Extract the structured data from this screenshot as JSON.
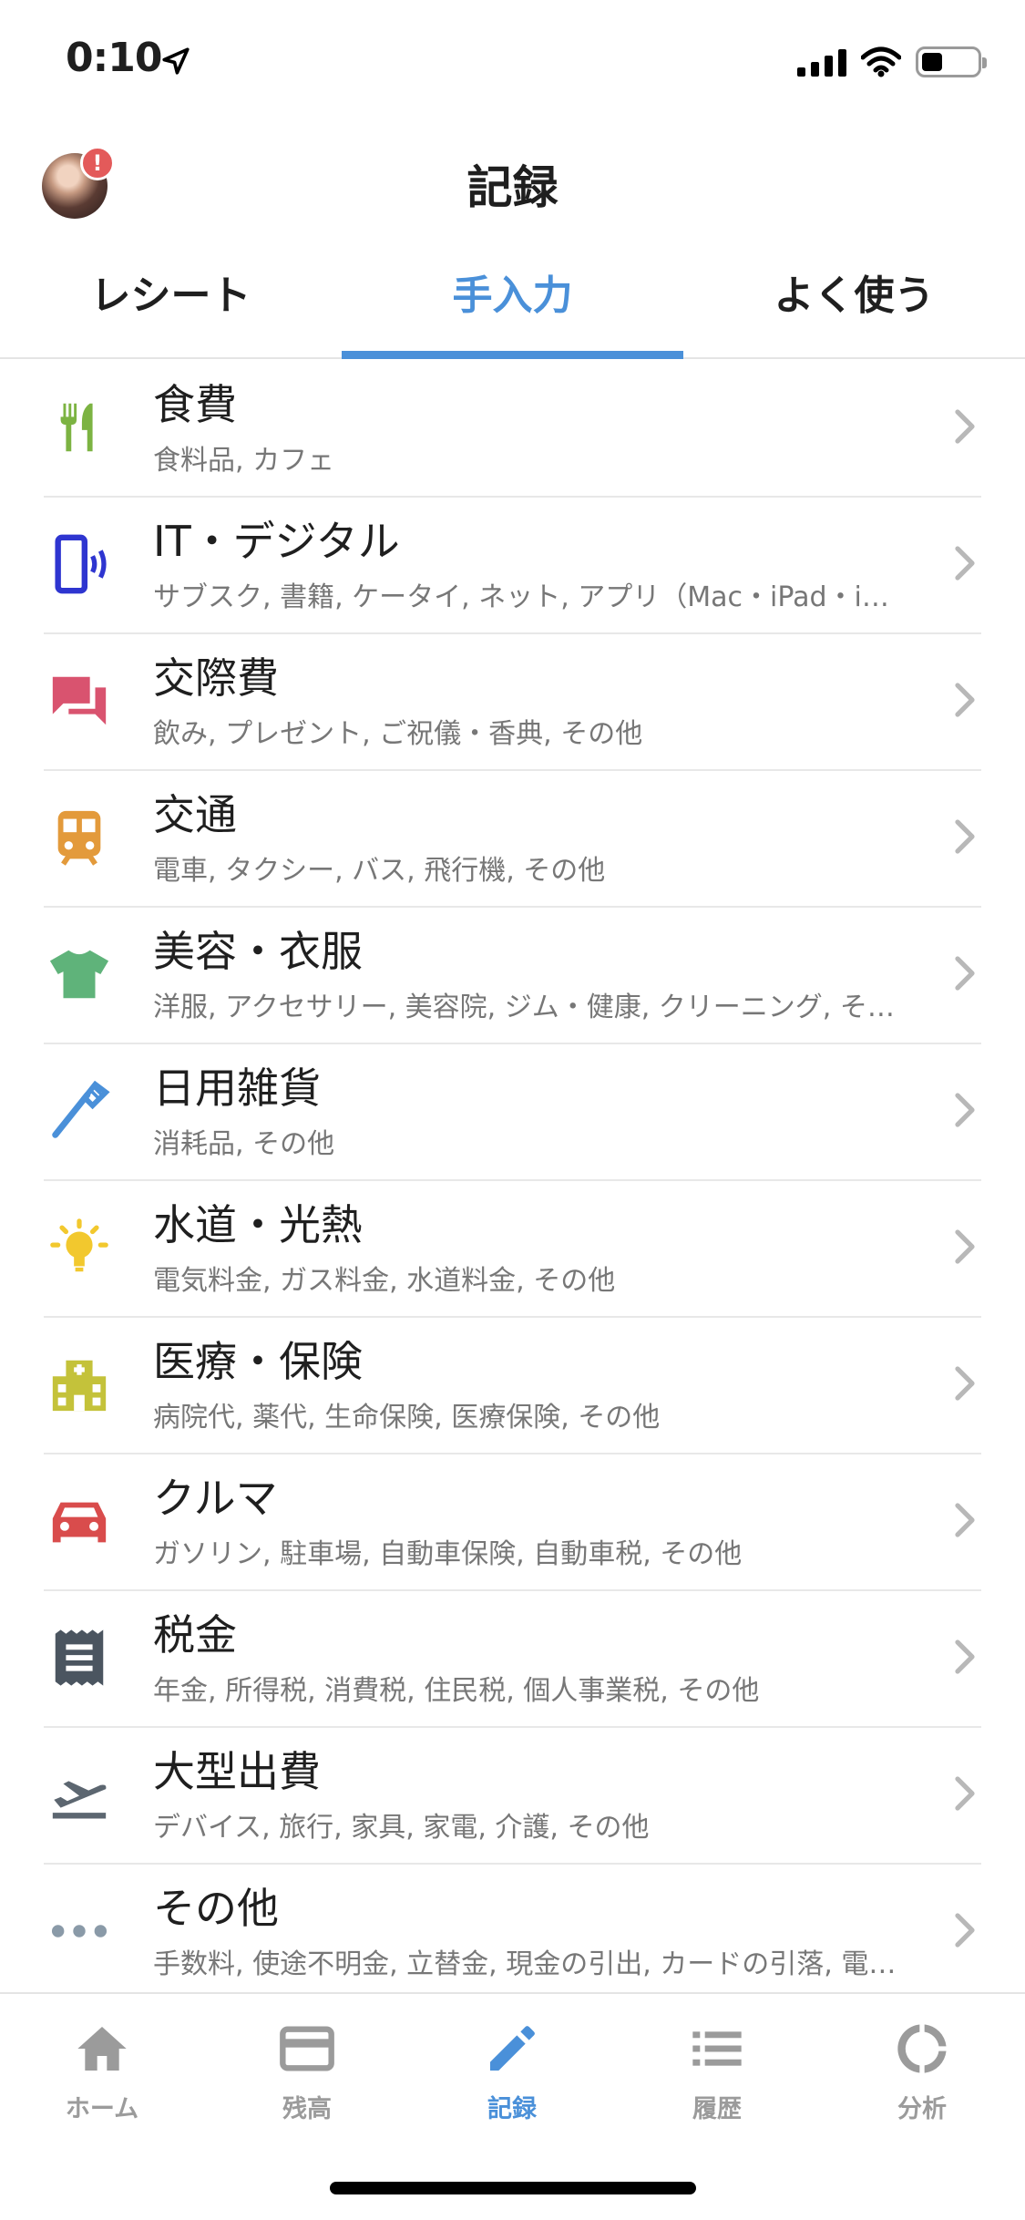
{
  "status_bar": {
    "time": "0:10"
  },
  "header": {
    "title": "記録",
    "avatar_badge": "!"
  },
  "tabs": [
    {
      "label": "レシート",
      "active": false
    },
    {
      "label": "手入力",
      "active": true
    },
    {
      "label": "よく使う",
      "active": false
    }
  ],
  "categories": [
    {
      "title": "食費",
      "subtitle": "食料品, カフェ",
      "icon": "fork-knife-icon",
      "color": "#7cb342"
    },
    {
      "title": "IT・デジタル",
      "subtitle": "サブスク, 書籍, ケータイ, ネット, アプリ（Mac・iPad・i…",
      "icon": "smartphone-icon",
      "color": "#2e35d0"
    },
    {
      "title": "交際費",
      "subtitle": "飲み, プレゼント, ご祝儀・香典, その他",
      "icon": "chat-bubbles-icon",
      "color": "#d9536f"
    },
    {
      "title": "交通",
      "subtitle": "電車, タクシー, バス, 飛行機, その他",
      "icon": "train-icon",
      "color": "#e39a3b"
    },
    {
      "title": "美容・衣服",
      "subtitle": "洋服, アクセサリー, 美容院, ジム・健康, クリーニング, そ…",
      "icon": "tshirt-icon",
      "color": "#5fb37a"
    },
    {
      "title": "日用雑貨",
      "subtitle": "消耗品, その他",
      "icon": "toothbrush-icon",
      "color": "#4a90d9"
    },
    {
      "title": "水道・光熱",
      "subtitle": "電気料金, ガス料金, 水道料金, その他",
      "icon": "lightbulb-icon",
      "color": "#f2c82e"
    },
    {
      "title": "医療・保険",
      "subtitle": "病院代, 薬代, 生命保険, 医療保険, その他",
      "icon": "hospital-icon",
      "color": "#c4c23a"
    },
    {
      "title": "クルマ",
      "subtitle": "ガソリン, 駐車場, 自動車保険, 自動車税, その他",
      "icon": "car-icon",
      "color": "#d94c4c"
    },
    {
      "title": "税金",
      "subtitle": "年金, 所得税, 消費税, 住民税, 個人事業税, その他",
      "icon": "receipt-icon",
      "color": "#4b5560"
    },
    {
      "title": "大型出費",
      "subtitle": "デバイス, 旅行, 家具, 家電, 介護, その他",
      "icon": "airplane-takeoff-icon",
      "color": "#5c6670"
    },
    {
      "title": "その他",
      "subtitle": "手数料, 使途不明金, 立替金, 現金の引出, カードの引落, 電…",
      "icon": "more-dots-icon",
      "color": "#8a9aa8"
    }
  ],
  "bottom_nav": [
    {
      "label": "ホーム",
      "icon": "home-icon",
      "active": false
    },
    {
      "label": "残高",
      "icon": "card-icon",
      "active": false
    },
    {
      "label": "記録",
      "icon": "pencil-icon",
      "active": true
    },
    {
      "label": "履歴",
      "icon": "list-icon",
      "active": false
    },
    {
      "label": "分析",
      "icon": "donut-chart-icon",
      "active": false
    }
  ],
  "colors": {
    "accent": "#4a90d9",
    "inactive": "#9b9b9b",
    "badge": "#e35a5a"
  }
}
